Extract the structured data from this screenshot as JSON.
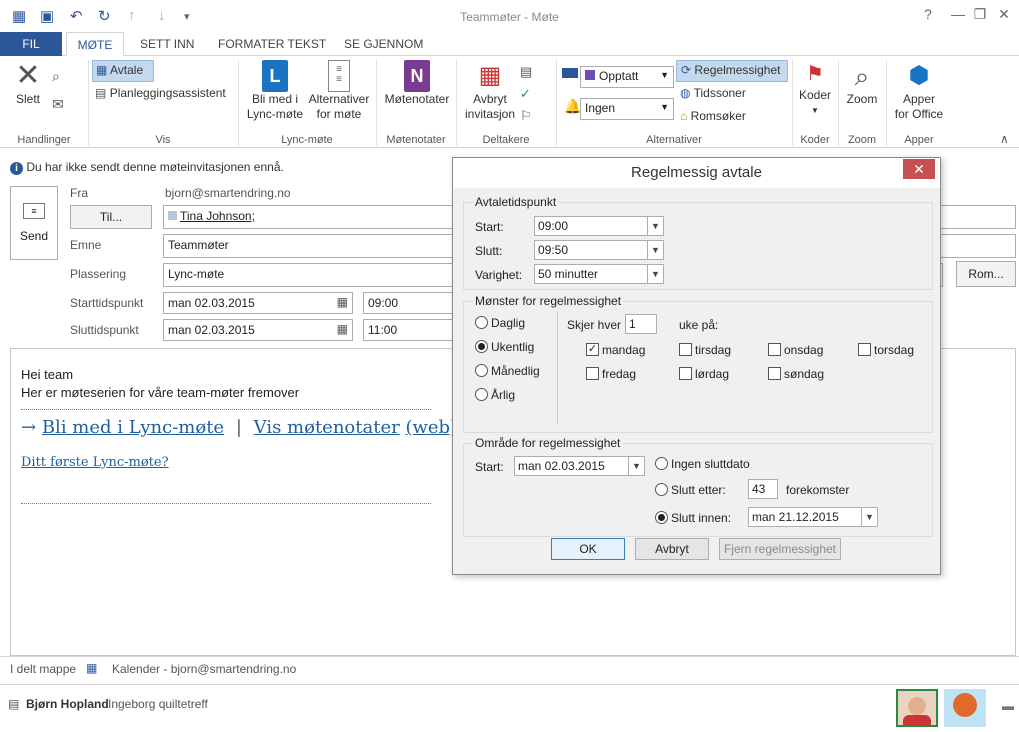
{
  "window": {
    "title": "Teammøter - Møte",
    "help": "?",
    "minimize": "—",
    "restore": "❐",
    "close": "✕"
  },
  "tabs": {
    "file": "FIL",
    "items": [
      "MØTE",
      "SETT INN",
      "FORMATER TEKST",
      "SE GJENNOM"
    ]
  },
  "ribbon": {
    "groups": {
      "handlinger": "Handlinger",
      "vis": "Vis",
      "lync": "Lync-møte",
      "motenotater": "Møtenotater",
      "deltakere": "Deltakere",
      "alternativer": "Alternativer",
      "koder": "Koder",
      "zoom": "Zoom",
      "apper": "Apper"
    },
    "slett": "Slett",
    "avtale": "Avtale",
    "planlegging": "Planleggingsassistent",
    "lync_join_1": "Bli med i",
    "lync_join_2": "Lync-møte",
    "alt_mote_1": "Alternativer",
    "alt_mote_2": "for møte",
    "motenotater": "Møtenotater",
    "avbryt_1": "Avbryt",
    "avbryt_2": "invitasjon",
    "show_as": "Opptatt",
    "reminder": "Ingen",
    "regelmessighet": "Regelmessighet",
    "tidssoner": "Tidssoner",
    "romsoker": "Romsøker",
    "koder": "Koder",
    "zoom": "Zoom",
    "apper_1": "Apper",
    "apper_2": "for Office",
    "collapse": "∧"
  },
  "form": {
    "info": "Du har ikke sendt denne møteinvitasjonen ennå.",
    "send": "Send",
    "fra_label": "Fra",
    "fra_value": "bjorn@smartendring.no",
    "til_button": "Til...",
    "til_value": "Tina Johnson;",
    "emne_label": "Emne",
    "emne_value": "Teammøter",
    "plassering_label": "Plassering",
    "plassering_value": "Lync-møte",
    "rom_button": "Rom...",
    "start_label": "Starttidspunkt",
    "start_date": "man 02.03.2015",
    "start_time": "09:00",
    "slutt_label": "Sluttidspunkt",
    "slutt_date": "man 02.03.2015",
    "slutt_time": "11:00"
  },
  "body": {
    "line1": "Hei team",
    "line2": "Her er møteserien for våre team-møter fremover",
    "arrow": "→",
    "join_link": "Bli med i Lync-møte",
    "bar": "|",
    "notes_link": "Vis møtenotater",
    "web_link": "(web)",
    "first_link": "Ditt første Lync-møte?"
  },
  "dialog": {
    "title": "Regelmessig avtale",
    "close": "✕",
    "tid_legend": "Avtaletidspunkt",
    "start_label": "Start:",
    "start_value": "09:00",
    "slutt_label": "Slutt:",
    "slutt_value": "09:50",
    "varighet_label": "Varighet:",
    "varighet_value": "50 minutter",
    "monster_legend": "Mønster for regelmessighet",
    "daglig": "Daglig",
    "ukentlig": "Ukentlig",
    "manedlig": "Månedlig",
    "arlig": "Årlig",
    "skjer_hver": "Skjer hver",
    "interval": "1",
    "uke_pa": "uke på:",
    "days": [
      "mandag",
      "tirsdag",
      "onsdag",
      "torsdag",
      "fredag",
      "lørdag",
      "søndag"
    ],
    "omrade_legend": "Område for regelmessighet",
    "omrade_start_label": "Start:",
    "omrade_start_value": "man 02.03.2015",
    "ingen_slutt": "Ingen sluttdato",
    "slutt_etter": "Slutt etter:",
    "count": "43",
    "forekomster": "forekomster",
    "slutt_innen": "Slutt innen:",
    "slutt_innen_value": "man 21.12.2015",
    "ok": "OK",
    "avbryt": "Avbryt",
    "fjern": "Fjern regelmessighet"
  },
  "folder": {
    "label": "I delt mappe",
    "value": "Kalender - bjorn@smartendring.no"
  },
  "people": {
    "name": "Bjørn Hopland",
    "status": "Ingeborg quiltetreff"
  },
  "colors": {
    "accent": "#2b579a",
    "close_red": "#c75050",
    "link": "#1f5f9f"
  }
}
